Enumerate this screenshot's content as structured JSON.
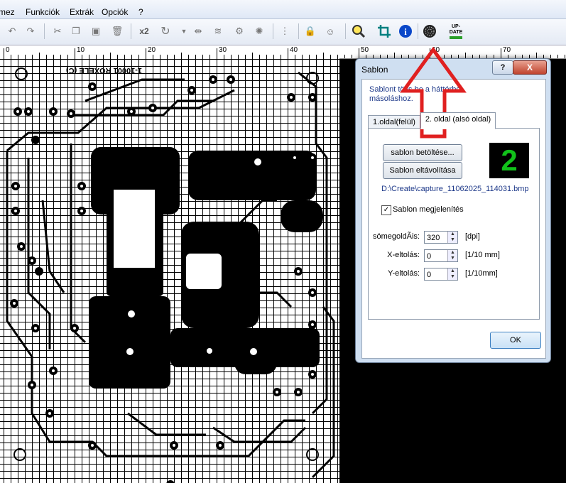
{
  "menu": {
    "items": [
      "mez",
      "Funkciók",
      "Extrák",
      "Opciók",
      "?"
    ]
  },
  "toolbar": {
    "zoom_label": "x2",
    "update_label_top": "UP-",
    "update_label_bottom": "DATE"
  },
  "ruler": {
    "labels": [
      "0",
      "10",
      "20",
      "30",
      "40",
      "50",
      "60",
      "70"
    ]
  },
  "board": {
    "mirrored_text": "1-10001 ROXELE (C)"
  },
  "dialog": {
    "title": "Sablon",
    "help_label": "?",
    "close_label": "X",
    "info_text": "Sablont tölts be a háttérbe másoláshoz.",
    "tabs": [
      "1.oldal(felül)",
      "2. oldal (alsó oldal)"
    ],
    "load_button": "sablon betöltése...",
    "remove_button": "Sablon eltávolítása",
    "side_number": "2",
    "file_path": "D:\\Create\\capture_11062025_114031.bmp",
    "show_checkbox_label": "Sablon megjelenítés",
    "show_checked": true,
    "fields": [
      {
        "label": "sömegoldÃis:",
        "value": "320",
        "unit": "[dpi]"
      },
      {
        "label": "X-eltolás:",
        "value": "0",
        "unit": "[1/10 mm]"
      },
      {
        "label": "Y-eltolás:",
        "value": "0",
        "unit": "[1/10mm]"
      }
    ],
    "ok_button": "OK"
  },
  "colors": {
    "accent_arrow": "#e02020",
    "side_badge": "#11c11a"
  }
}
